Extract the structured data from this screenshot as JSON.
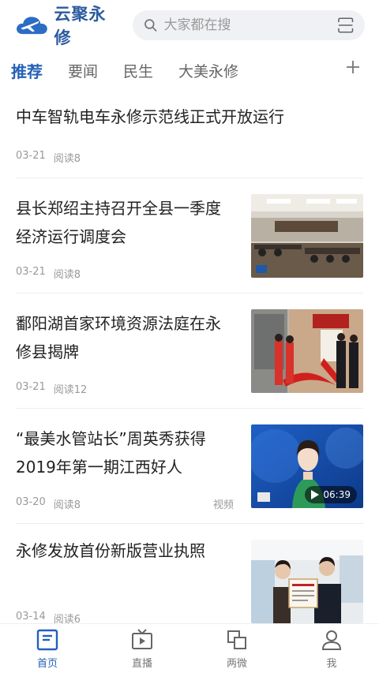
{
  "header": {
    "app_name": "云聚永修",
    "search_placeholder": "大家都在搜"
  },
  "tabs": [
    {
      "label": "推荐",
      "active": true
    },
    {
      "label": "要闻",
      "active": false
    },
    {
      "label": "民生",
      "active": false
    },
    {
      "label": "大美永修",
      "active": false
    }
  ],
  "articles": [
    {
      "title": "中车智轨电车永修示范线正式开放运行",
      "date": "03-21",
      "reads": "阅读8",
      "tag": ""
    },
    {
      "title": "县长郑绍主持召开全县一季度经济运行调度会",
      "date": "03-21",
      "reads": "阅读8",
      "tag": ""
    },
    {
      "title": "鄱阳湖首家环境资源法庭在永修县揭牌",
      "date": "03-21",
      "reads": "阅读12",
      "tag": ""
    },
    {
      "title": "“最美水管站长”周英秀获得2019年第一期江西好人",
      "date": "03-20",
      "reads": "阅读8",
      "tag": "视频",
      "duration": "06:39"
    },
    {
      "title": "永修发放首份新版营业执照",
      "date": "03-14",
      "reads": "阅读6",
      "tag": ""
    }
  ],
  "bottom_nav": [
    {
      "label": "首页",
      "icon": "home-icon",
      "active": true
    },
    {
      "label": "直播",
      "icon": "tv-icon",
      "active": false
    },
    {
      "label": "两微",
      "icon": "link-icon",
      "active": false
    },
    {
      "label": "我",
      "icon": "user-icon",
      "active": false
    }
  ],
  "colors": {
    "accent": "#2560b9",
    "logo": "#2c5aa0",
    "search_bg": "#f0f1f4"
  }
}
